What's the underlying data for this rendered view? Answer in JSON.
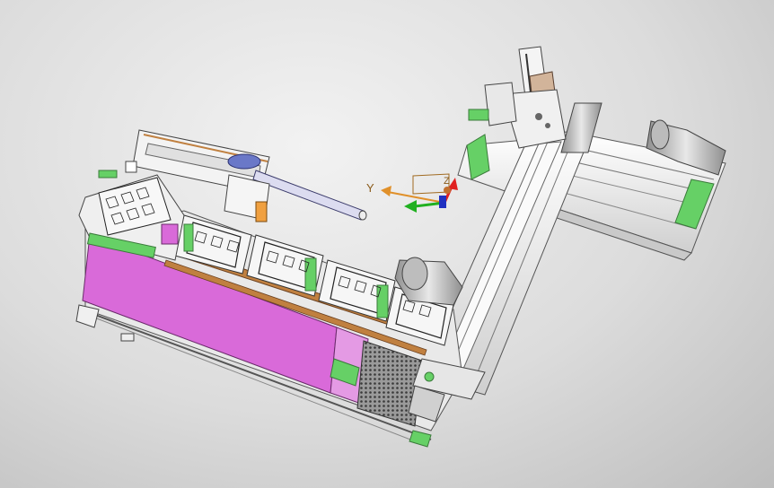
{
  "viewport": {
    "background_top": "#f2f2f2",
    "background_bottom": "#bdbdbd"
  },
  "triad": {
    "x_label": "",
    "y_label": "Y",
    "z_label": "Z",
    "y_color": "#e0902a",
    "x_color": "#20b020",
    "z_color": "#e02020"
  },
  "model": {
    "frame_color": "#f3f3f3",
    "panel_color": "#d96ad9",
    "accent_color": "#66d066",
    "motor_color": "#b9b9b9",
    "belt_color": "#c08040"
  }
}
